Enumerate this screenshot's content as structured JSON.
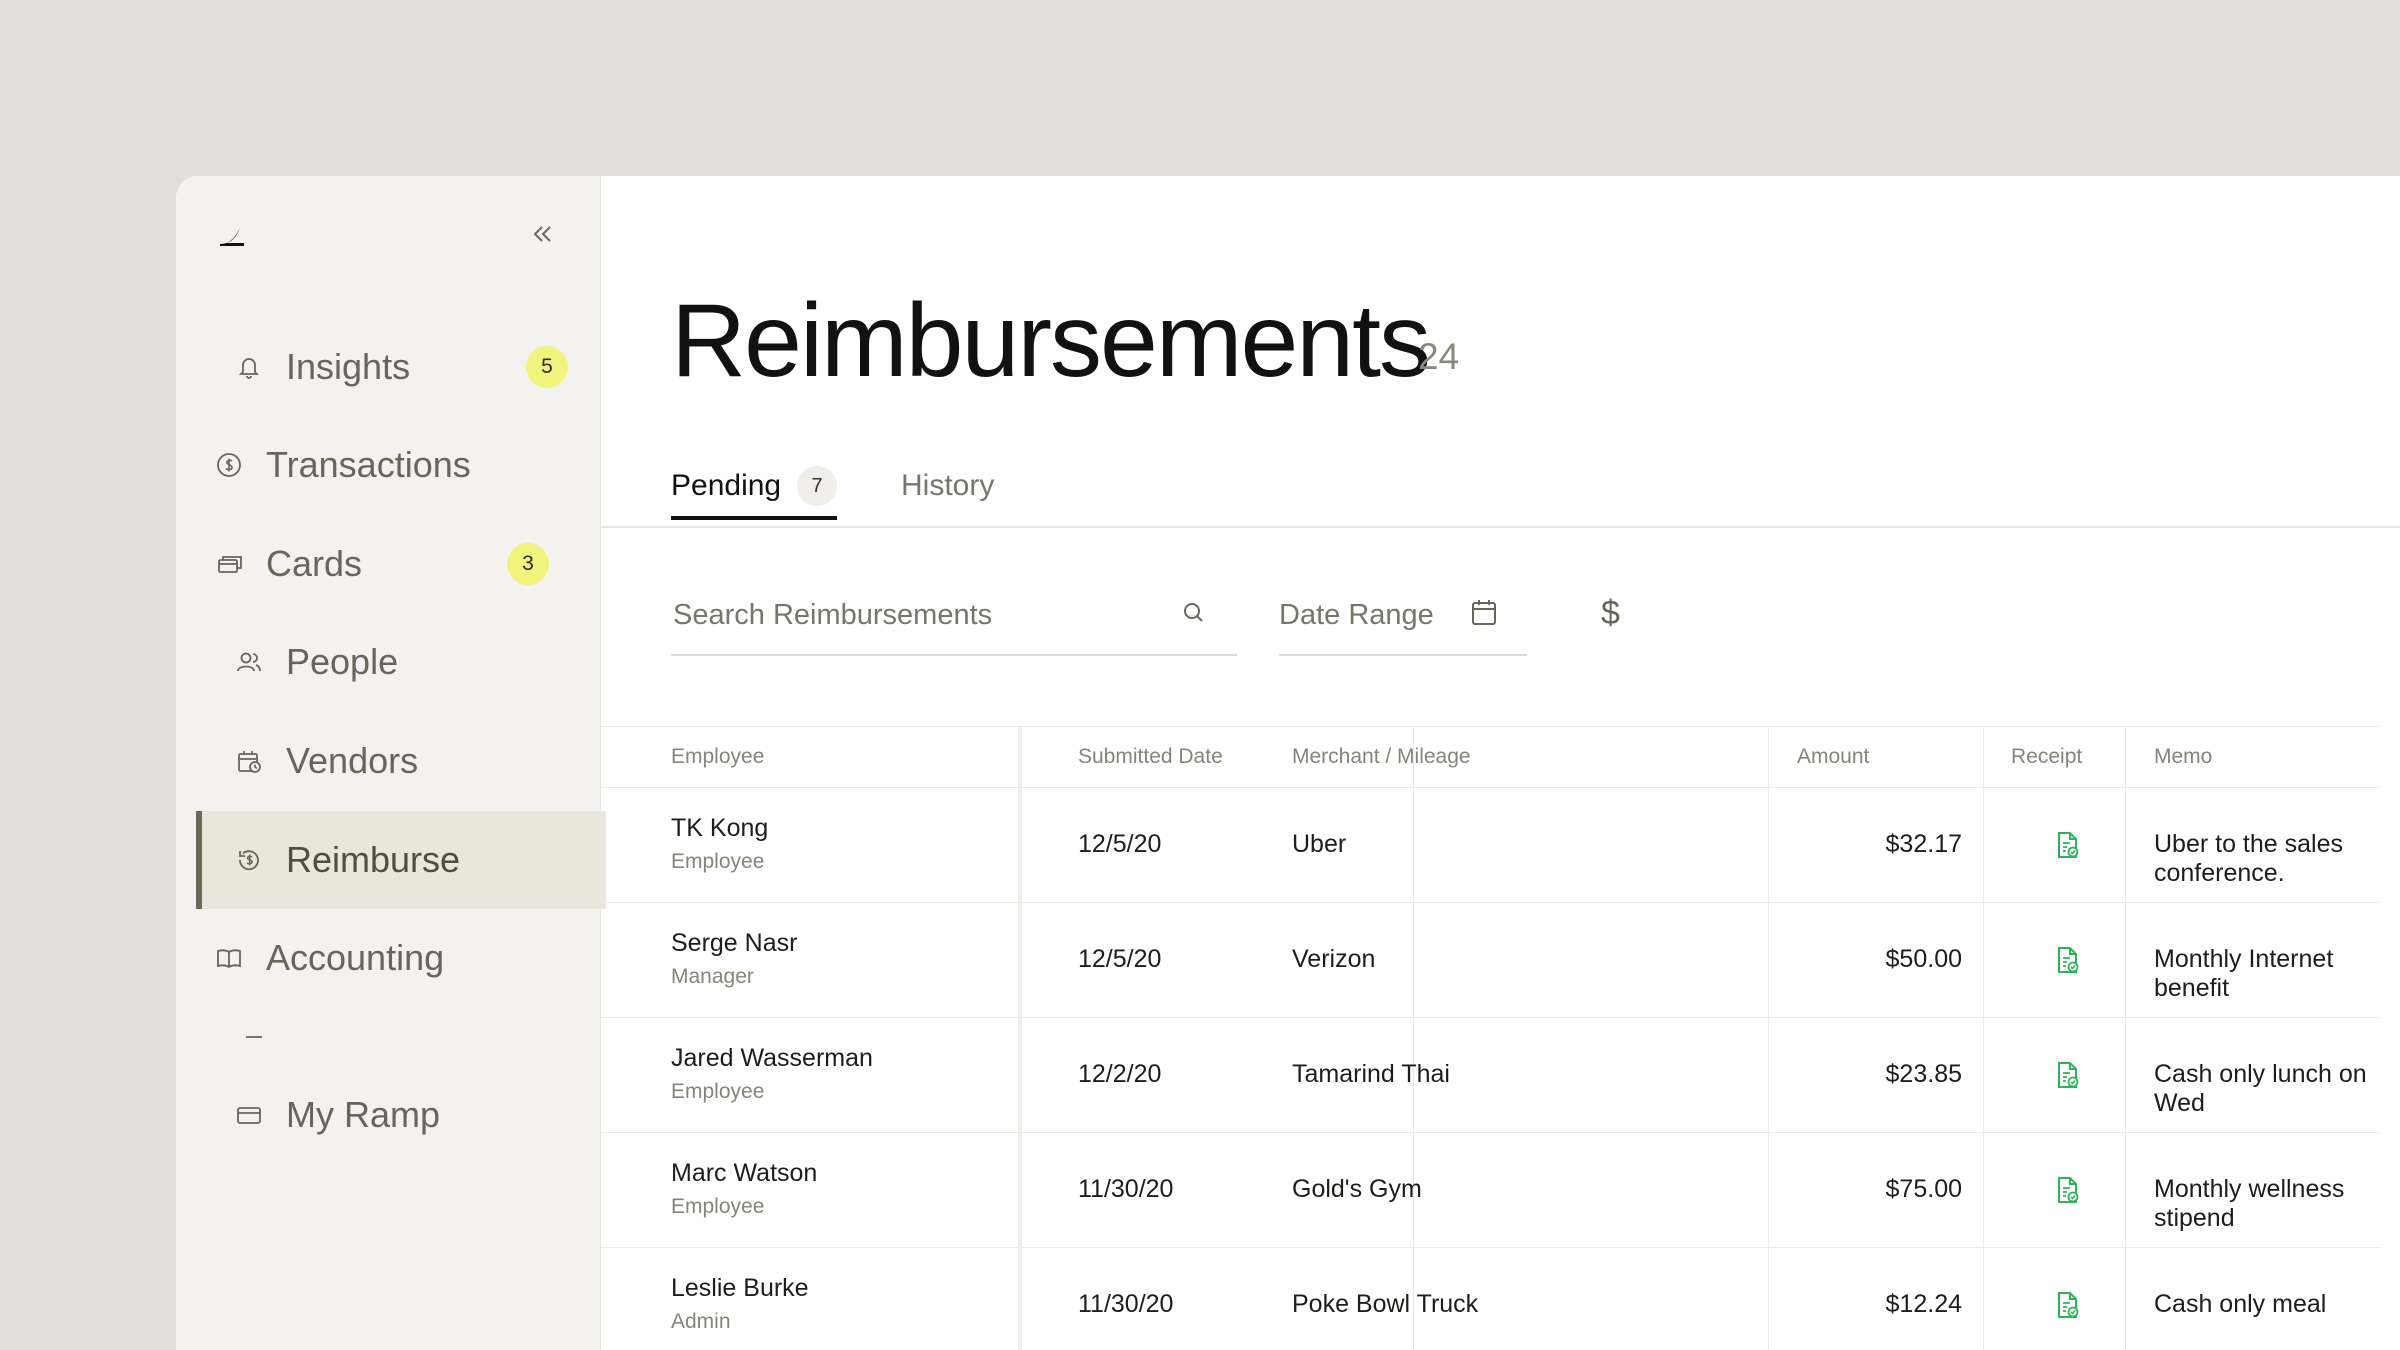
{
  "sidebar": {
    "logo_icon": "ramp-logo-icon",
    "collapse_icon": "double-chevron-left-icon",
    "items": [
      {
        "label": "Insights",
        "icon": "bell-icon",
        "badge": "5"
      },
      {
        "label": "Transactions",
        "icon": "dollar-circle-icon"
      },
      {
        "label": "Cards",
        "icon": "cards-icon",
        "badge": "3"
      },
      {
        "label": "People",
        "icon": "people-icon"
      },
      {
        "label": "Vendors",
        "icon": "vendors-icon"
      },
      {
        "label": "Reimburse",
        "icon": "reimburse-icon",
        "active": true
      },
      {
        "label": "Accounting",
        "icon": "book-icon"
      },
      {
        "label": "My Ramp",
        "icon": "card-icon"
      }
    ]
  },
  "page": {
    "title": "Reimbursements",
    "count": "24"
  },
  "tabs": [
    {
      "label": "Pending",
      "count": "7",
      "active": true
    },
    {
      "label": "History"
    }
  ],
  "filters": {
    "search_placeholder": "Search Reimbursements",
    "date_label": "Date Range",
    "amount_symbol": "$"
  },
  "table": {
    "columns": [
      "Employee",
      "Submitted Date",
      "Merchant / Mileage",
      "Amount",
      "Receipt",
      "Memo"
    ],
    "rows": [
      {
        "name": "TK Kong",
        "role": "Employee",
        "date": "12/5/20",
        "merchant": "Uber",
        "amount": "$32.17",
        "memo": "Uber to the sales conference."
      },
      {
        "name": "Serge Nasr",
        "role": "Manager",
        "date": "12/5/20",
        "merchant": "Verizon",
        "amount": "$50.00",
        "memo": "Monthly Internet benefit"
      },
      {
        "name": "Jared Wasserman",
        "role": "Employee",
        "date": "12/2/20",
        "merchant": "Tamarind Thai",
        "amount": "$23.85",
        "memo": "Cash only lunch on Wed"
      },
      {
        "name": "Marc Watson",
        "role": "Employee",
        "date": "11/30/20",
        "merchant": "Gold's Gym",
        "amount": "$75.00",
        "memo": "Monthly wellness stipend"
      },
      {
        "name": "Leslie Burke",
        "role": "Admin",
        "date": "11/30/20",
        "merchant": "Poke Bowl Truck",
        "amount": "$12.24",
        "memo": "Cash only meal"
      }
    ]
  },
  "colors": {
    "accent_badge": "#f1f57e",
    "receipt_green": "#2fb35a",
    "sidebar_bg": "#f3f2ee",
    "active_bg": "#e8e7dc"
  }
}
